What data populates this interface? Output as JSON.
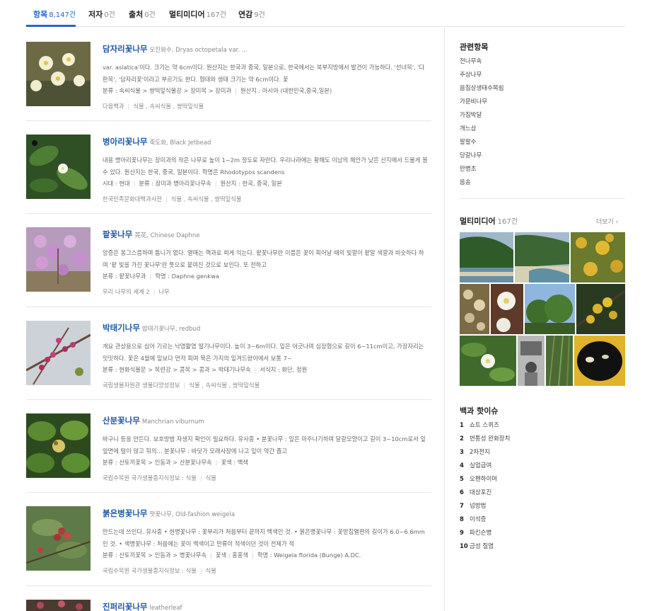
{
  "tabs": [
    {
      "label": "항목",
      "count": "8,147건"
    },
    {
      "label": "저자",
      "count": "0건"
    },
    {
      "label": "출처",
      "count": "0건"
    },
    {
      "label": "멀티미디어",
      "count": "167건"
    },
    {
      "label": "연감",
      "count": "9건"
    }
  ],
  "results": [
    {
      "title": "담자리꽃나무",
      "subtitle": "모진화수, Dryas octopetala var. ...",
      "desc": "var. asiatica'이다. 크기는 약 6cm이다. 원산지는 한국과 중국, 일본으로, 한국에서는 북부지방에서 발견이 가능하다. '선녀목', '다판목', '담자리꽃'이라고 부르기도 한다. 형태와 생태 크기는 약 6cm이다. 꽃",
      "meta": [
        "분류 : 속씨식물 > 쌍떡잎식물강 > 장미목 > 장미과",
        "원산지 : 아시아 (대한민국,중국,일본)"
      ],
      "source": [
        "다음백과",
        "식물 , 속씨식물 , 쌍떡잎식물"
      ]
    },
    {
      "title": "병아리꽃나무",
      "subtitle": "죽도화, Black Jetbead",
      "desc": "내용 병아리꽃나무는 장미과의 작은 나무로 높이 1~2m 정도로 자란다. 우리나라에는 황해도 이남의 해안가 낮은 산지에서 드물게 볼 수 있다. 원산지는 한국, 중국, 일본이다. 학명은 Rhodotypos scandens",
      "meta": [
        "시대 : 현대",
        "분류 : 장미과 병아리꽃나무속",
        "원산지 : 한국, 중국, 일본"
      ],
      "source": [
        "한국민족문화대백과사전",
        "식물 , 속씨식물 , 쌍떡잎식물"
      ]
    },
    {
      "title": "팥꽃나무",
      "subtitle": "芫花, Chinese Daphne",
      "desc": "앙증은 몽그스름하며 톱니가 없다. 열매는 핵과로 희게 익는다. 팥꽃나무란 이름은 꽃이 피어날 때의 빛깔이 팥알 색깔과 비슷하다 하여 '팥 빛을 가진 꽃나무'란 뜻으로 붙여진 것으로 보인다. 또 전하고",
      "meta": [
        "분류 : 팥꽃나무과",
        "학명 : Daphne genkwa"
      ],
      "source": [
        "우리 나무의 세계 2",
        "나무"
      ]
    },
    {
      "title": "박태기나무",
      "subtitle": "밥태기꽃나무, redbud",
      "desc": "개요 관상용으로 심어 기르는 낙엽활엽 떨기나무이다. 높이 3~6m이다. 잎은 어긋나며 심장형으로 길이 6~11cm이고, 가장자리는 밋밋하다. 꽃은 4월에 잎보다 먼저 피며 묵은 가지의 잎겨드랑이에서 보통 7~",
      "meta": [
        "분류 : 현화식물문 > 목련강 > 콩목 > 콩과 > 박태기나무속",
        "서식지 : 화단, 정원"
      ],
      "source": [
        "국립생물자원관 생물다양성정보",
        "식물 , 속씨식물 , 쌍떡잎식물"
      ]
    },
    {
      "title": "산분꽃나무",
      "subtitle": "Manchrian viburnum",
      "desc": "바구니 등을 만든다. 보호방법 자생지 확인이 필요하다. 유사종 • 분꽃나무 : 잎은 마주나기하며 달걀모양이고 길이 3~10cm로서 잎 앞면에 털이 많고 뒤의... 분꽃나무 : 바닷가 모래사장에 나고 잎이 약간 좁고",
      "meta": [
        "분류 : 산토끼꽃목 > 인동과 > 산분꽃나무속",
        "꽃색 : 백색"
      ],
      "source": [
        "국립수목원 국가생물종지식정보 : 식물",
        "식물"
      ]
    },
    {
      "title": "붉은병꽃나무",
      "subtitle": "팟꽃나무, Old-fashion weigela",
      "desc": "만드는데 쓰인다. 유사종 • 헌병꽃나무 : 꽃부리가 처음부터 끝까지 백색인 것. • 붉은병꽃나무 : 꽃받침열편의 길이가 6.0~6.6mm인 것. • 색병꽃나무 : 처음에는 꽃이 백색이고 만류이 적색이던 것이 전체가 적",
      "meta": [
        "분류 : 산토끼꽃목 > 인동과 > 병꽃나무속",
        "꽃색 : 홍홍색",
        "학명 : Weigela florida (Bunge) A.DC."
      ],
      "source": [
        "국립수목원 국가생물종지식정보 : 식물",
        "식물"
      ]
    },
    {
      "title": "진퍼리꽃나무",
      "subtitle": "leatherleaf",
      "desc": "",
      "meta": [],
      "source": []
    }
  ],
  "related": {
    "heading": "관련항목",
    "items": [
      "전나무속",
      "주상나무",
      "음침상생태수목림",
      "가문비나무",
      "가침박달",
      "개느삼",
      "팔팔수",
      "당갈나무",
      "만병초",
      "음송"
    ]
  },
  "multimedia": {
    "heading": "멀티미디어",
    "count": "167건",
    "more": "더보기"
  },
  "issues": {
    "heading": "백과 핫이슈",
    "items": [
      {
        "rank": "1",
        "label": "쇼트 스퀴즈"
      },
      {
        "rank": "2",
        "label": "번통성 완화장치"
      },
      {
        "rank": "3",
        "label": "2차전지"
      },
      {
        "rank": "4",
        "label": "실업급여"
      },
      {
        "rank": "5",
        "label": "오펜하이머"
      },
      {
        "rank": "6",
        "label": "대상포진"
      },
      {
        "rank": "7",
        "label": "넘방범"
      },
      {
        "rank": "8",
        "label": "이석증"
      },
      {
        "rank": "9",
        "label": "파킨슨병"
      },
      {
        "rank": "10",
        "label": "금성 질염"
      }
    ]
  },
  "colors": {
    "accent": "#2765c6",
    "title": "#1f5aa6"
  }
}
